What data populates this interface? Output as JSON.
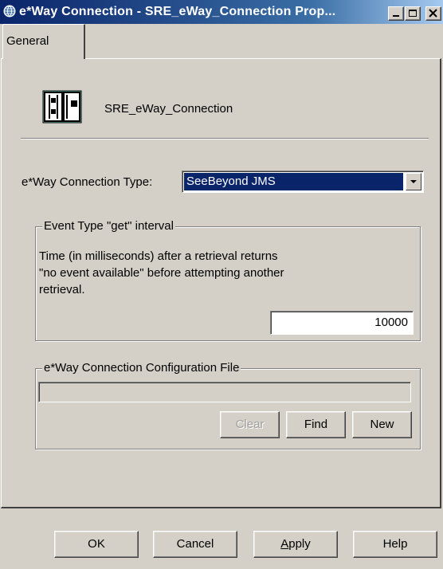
{
  "window": {
    "title": "e*Way Connection - SRE_eWay_Connection Prop..."
  },
  "tabs": [
    {
      "label": "General"
    }
  ],
  "connection": {
    "name": "SRE_eWay_Connection"
  },
  "type_row": {
    "label": "e*Way Connection Type:",
    "selected": "SeeBeyond JMS"
  },
  "interval_group": {
    "legend": "Event Type \"get\" interval",
    "description": "Time (in milliseconds) after a retrieval returns \"no event available\" before attempting another retrieval.",
    "value": "10000"
  },
  "config_group": {
    "legend": "e*Way Connection Configuration File",
    "path": "",
    "buttons": {
      "clear": "Clear",
      "find": "Find",
      "new": "New"
    }
  },
  "dialog_buttons": {
    "ok": "OK",
    "cancel": "Cancel",
    "apply_first": "A",
    "apply_rest": "pply",
    "help": "Help"
  },
  "colors": {
    "titlebar": "#0a246a",
    "face": "#d4d0c8",
    "selection": "#0a246a"
  }
}
